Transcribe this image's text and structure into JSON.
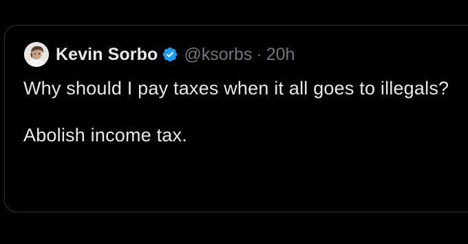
{
  "tweet": {
    "author": {
      "name": "Kevin Sorbo",
      "handle": "@ksorbs",
      "verified": true,
      "avatar_icon": "profile-photo"
    },
    "separator": "·",
    "timestamp": "20h",
    "text_lines": [
      "Why should I pay taxes when it all goes to illegals?",
      "Abolish income tax."
    ]
  },
  "colors": {
    "background": "#000000",
    "border": "#2f3336",
    "primary_text": "#e7e9ea",
    "secondary_text": "#71767b",
    "verified_badge": "#1d9bf0"
  }
}
